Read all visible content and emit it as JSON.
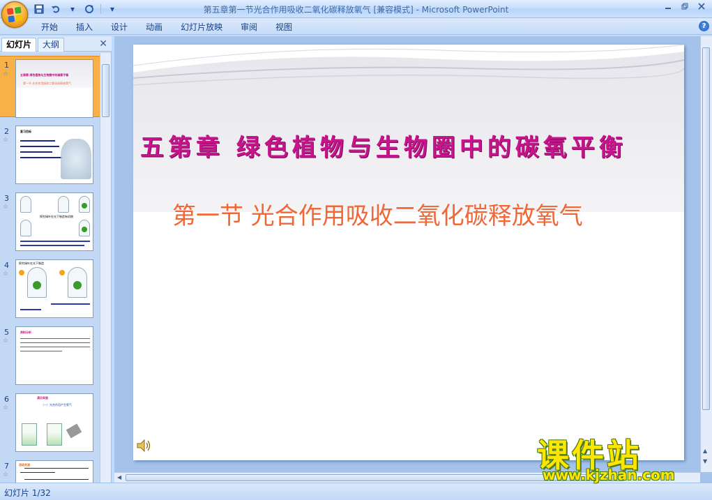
{
  "window": {
    "title": "第五章第一节光合作用吸收二氧化碳释放氧气 [兼容模式] - Microsoft PowerPoint"
  },
  "ribbon": {
    "tabs": [
      "开始",
      "插入",
      "设计",
      "动画",
      "幻灯片放映",
      "审阅",
      "视图"
    ]
  },
  "left_pane": {
    "tabs": [
      "幻灯片",
      "大纲"
    ],
    "active_tab": "幻灯片",
    "thumbnails": [
      {
        "number": "1",
        "title": "五第章 绿色植物与生物圈中的碳氧平衡",
        "subtitle": "第一节 光合作用吸收二氧化碳释放氧气"
      },
      {
        "number": "2",
        "title": "复习目标"
      },
      {
        "number": "3",
        "title": "探究绿叶在光下制造有机物"
      },
      {
        "number": "4",
        "title": "探究绿叶在光下制造"
      },
      {
        "number": "5",
        "title": "资料分析"
      },
      {
        "number": "6",
        "title": "演示实验",
        "subtitle": "（一）光合作用产生氧气"
      },
      {
        "number": "7",
        "title": "活动交流"
      }
    ]
  },
  "slide": {
    "title": "五第章  绿色植物与生物圈中的碳氧平衡",
    "subtitle": "第一节  光合作用吸收二氧化碳释放氧气"
  },
  "status": {
    "slide_indicator": "幻灯片 1/32"
  },
  "watermark": {
    "main": "课件站",
    "url": "www.kjzhan.com"
  },
  "colors": {
    "title_magenta": "#c8148c",
    "subtitle_orange": "#f06838",
    "selected_thumb": "#f8b048"
  }
}
